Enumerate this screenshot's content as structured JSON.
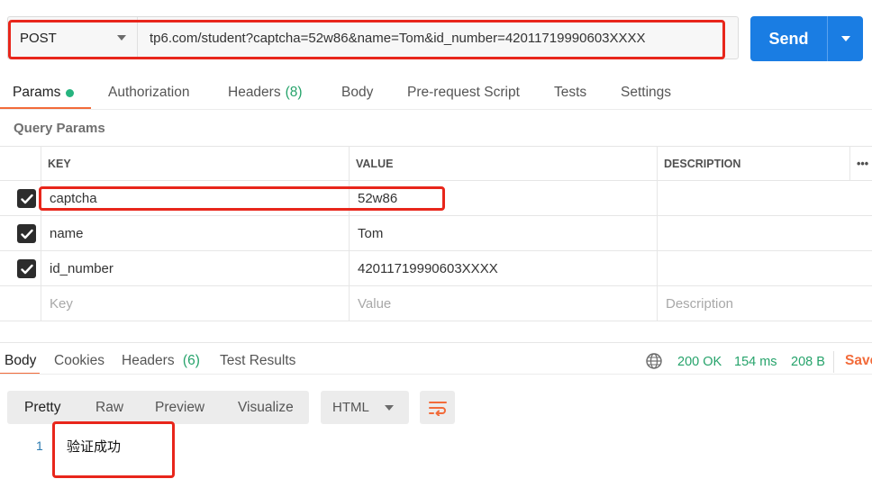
{
  "request": {
    "method": "POST",
    "url": "tp6.com/student?captcha=52w86&name=Tom&id_number=42011719990603XXXX",
    "send_label": "Send"
  },
  "request_tabs": {
    "params": "Params",
    "authorization": "Authorization",
    "headers": "Headers",
    "headers_count": "(8)",
    "body": "Body",
    "prerequest": "Pre-request Script",
    "tests": "Tests",
    "settings": "Settings"
  },
  "query_params": {
    "title": "Query Params",
    "columns": {
      "key": "KEY",
      "value": "VALUE",
      "description": "DESCRIPTION",
      "more": "•••"
    },
    "rows": [
      {
        "key": "captcha",
        "value": "52w86",
        "description": "",
        "checked": true
      },
      {
        "key": "name",
        "value": "Tom",
        "description": "",
        "checked": true
      },
      {
        "key": "id_number",
        "value": "42011719990603XXXX",
        "description": "",
        "checked": true
      }
    ],
    "placeholder": {
      "key": "Key",
      "value": "Value",
      "description": "Description"
    }
  },
  "response_tabs": {
    "body": "Body",
    "cookies": "Cookies",
    "headers": "Headers",
    "headers_count": "(6)",
    "test_results": "Test Results"
  },
  "response_status": {
    "status": "200 OK",
    "time": "154 ms",
    "size": "208 B",
    "save": "Save"
  },
  "view_modes": {
    "pretty": "Pretty",
    "raw": "Raw",
    "preview": "Preview",
    "visualize": "Visualize",
    "format": "HTML"
  },
  "response_body": {
    "line_number": "1",
    "content": "验证成功"
  },
  "colors": {
    "accent": "#f26b3a",
    "send": "#1a7de3",
    "success": "#26a36b",
    "highlight": "#e8261b"
  }
}
